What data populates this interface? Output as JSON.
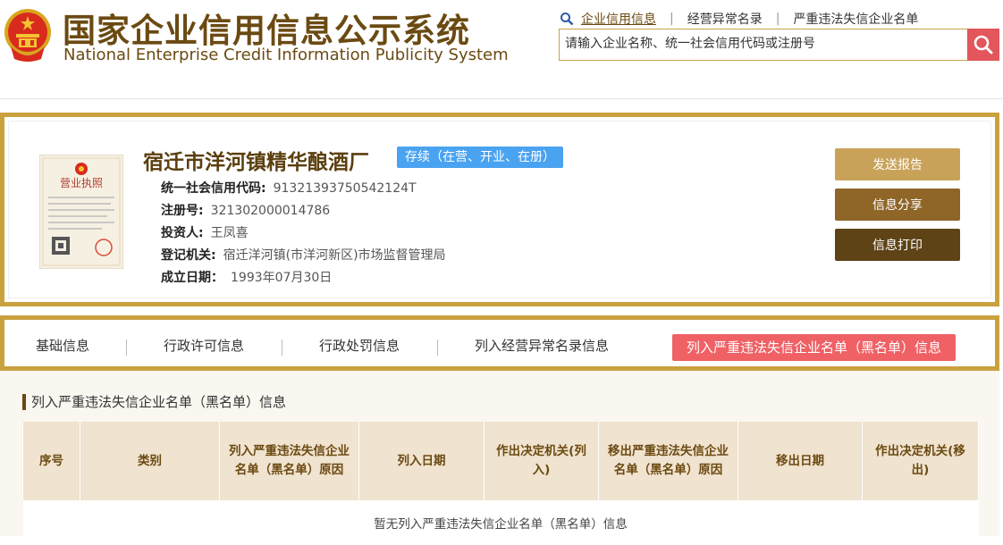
{
  "header": {
    "title_cn": "国家企业信用信息公示系统",
    "title_en": "National Enterprise Credit Information Publicity System",
    "nav": [
      "企业信用信息",
      "经营异常名录",
      "严重违法失信企业名单"
    ],
    "search_placeholder": "请输入企业名称、统一社会信用代码或注册号"
  },
  "company": {
    "name": "宿迁市洋河镇精华酿酒厂",
    "status": "存续（在营、开业、在册）",
    "fields": [
      {
        "label": "统一社会信用代码:",
        "value": "91321393750542124T"
      },
      {
        "label": "注册号:",
        "value": "321302000014786"
      },
      {
        "label": "投资人:",
        "value": "王凤喜"
      },
      {
        "label": "登记机关:",
        "value": "宿迁洋河镇(市洋河新区)市场监督管理局"
      },
      {
        "label": "成立日期：",
        "value": "1993年07月30日"
      }
    ],
    "license_text": "营业执照",
    "buttons": {
      "report": "发送报告",
      "share": "信息分享",
      "print": "信息打印"
    }
  },
  "tabs": [
    "基础信息",
    "行政许可信息",
    "行政处罚信息",
    "列入经营异常名录信息",
    "列入严重违法失信企业名单（黑名单）信息"
  ],
  "section": {
    "title": "列入严重违法失信企业名单（黑名单）信息",
    "columns": [
      "序号",
      "类别",
      "列入严重违法失信企业名单（黑名单）原因",
      "列入日期",
      "作出决定机关(列入)",
      "移出严重违法失信企业名单（黑名单）原因",
      "移出日期",
      "作出决定机关(移出)"
    ],
    "empty_text": "暂无列入严重违法失信企业名单（黑名单）信息"
  },
  "colors": {
    "gold": "#c9a13f",
    "brown": "#6b4a12",
    "active_tab": "#ef6165",
    "status_badge": "#4aa3f0",
    "search_button": "#e2565c"
  },
  "icons": [
    "national-emblem-icon",
    "search-icon",
    "magnifier-icon",
    "license-image"
  ]
}
